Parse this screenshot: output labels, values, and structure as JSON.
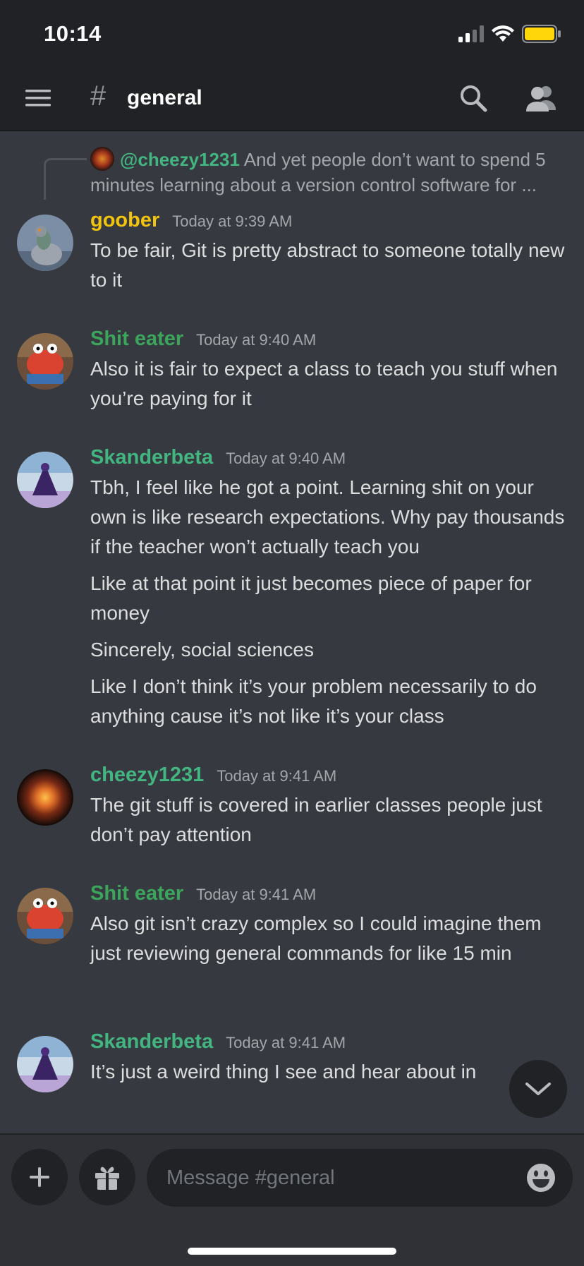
{
  "status_bar": {
    "time": "10:14"
  },
  "header": {
    "channel_name": "general"
  },
  "reply": {
    "author": "@cheezy1231",
    "text": "And yet people don’t want to spend 5 minutes learning about a version control software for ..."
  },
  "messages": [
    {
      "author": "goober",
      "author_color": "#f1c40f",
      "timestamp": "Today at 9:39 AM",
      "lines": [
        "To be fair, Git is pretty abstract to someone totally new to it"
      ]
    },
    {
      "author": "Shit eater",
      "author_color": "#3ba55c",
      "timestamp": "Today at 9:40 AM",
      "lines": [
        "Also it is fair to expect a class to teach you stuff when you’re paying for it"
      ]
    },
    {
      "author": "Skanderbeta",
      "author_color": "#43b581",
      "timestamp": "Today at 9:40 AM",
      "lines": [
        "Tbh, I feel like he got a point. Learning shit on your own is like research expectations. Why pay thousands if the teacher won’t actually teach you",
        "Like at that point it just becomes piece of paper for money",
        "Sincerely, social sciences",
        "Like I don’t think it’s your problem necessarily to do anything cause it’s not like it’s your class"
      ]
    },
    {
      "author": "cheezy1231",
      "author_color": "#43b581",
      "timestamp": "Today at 9:41 AM",
      "lines": [
        "The git stuff is covered in earlier classes people just don’t pay attention"
      ]
    },
    {
      "author": "Shit eater",
      "author_color": "#3ba55c",
      "timestamp": "Today at 9:41 AM",
      "lines": [
        "Also git isn’t crazy complex so I could imagine them just reviewing general commands for like 15 min"
      ]
    },
    {
      "author": "Skanderbeta",
      "author_color": "#43b581",
      "timestamp": "Today at 9:41 AM",
      "lines": [
        "It’s just a weird thing I see and hear about in"
      ]
    }
  ],
  "composer": {
    "placeholder": "Message #general"
  },
  "icons": [
    "menu-icon",
    "hash-icon",
    "search-icon",
    "members-icon",
    "plus-icon",
    "gift-icon",
    "emoji-icon",
    "chevron-down-icon"
  ],
  "colors": {
    "background": "#36393f",
    "header": "#202225",
    "composer_bar": "#2f3136",
    "green_author": "#43b581",
    "yellow_author": "#f1c40f"
  }
}
